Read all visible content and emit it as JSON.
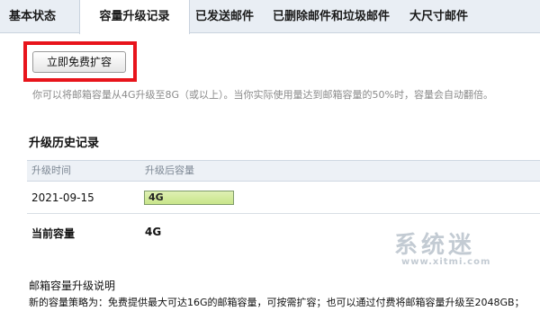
{
  "tabs": [
    {
      "label": "基本状态",
      "active": false
    },
    {
      "label": "容量升级记录",
      "active": true
    },
    {
      "label": "已发送邮件",
      "active": false
    },
    {
      "label": "已删除邮件和垃圾邮件",
      "active": false
    },
    {
      "label": "大尺寸邮件",
      "active": false
    }
  ],
  "upgrade": {
    "button_label": "立即免费扩容",
    "highlight_color": "#e8141b",
    "description": "你可以将邮箱容量从4G升级至8G（或以上）。当你实际使用量达到邮箱容量的50%时，容量会自动翻倍。"
  },
  "history": {
    "title": "升级历史记录",
    "columns": [
      "升级时间",
      "升级后容量"
    ],
    "rows": [
      {
        "date": "2021-09-15",
        "capacity": "4G",
        "fill_fraction": 1.0
      }
    ]
  },
  "current": {
    "label": "当前容量",
    "value": "4G"
  },
  "explanation": {
    "title": "邮箱容量升级说明",
    "text": "新的容量策略为：免费提供最大可达16G的邮箱容量，可按需扩容；也可以通过付费将邮箱容量升级至2048GB；"
  },
  "watermark": {
    "text": "系统迷",
    "url": "www.xitmi.com"
  }
}
